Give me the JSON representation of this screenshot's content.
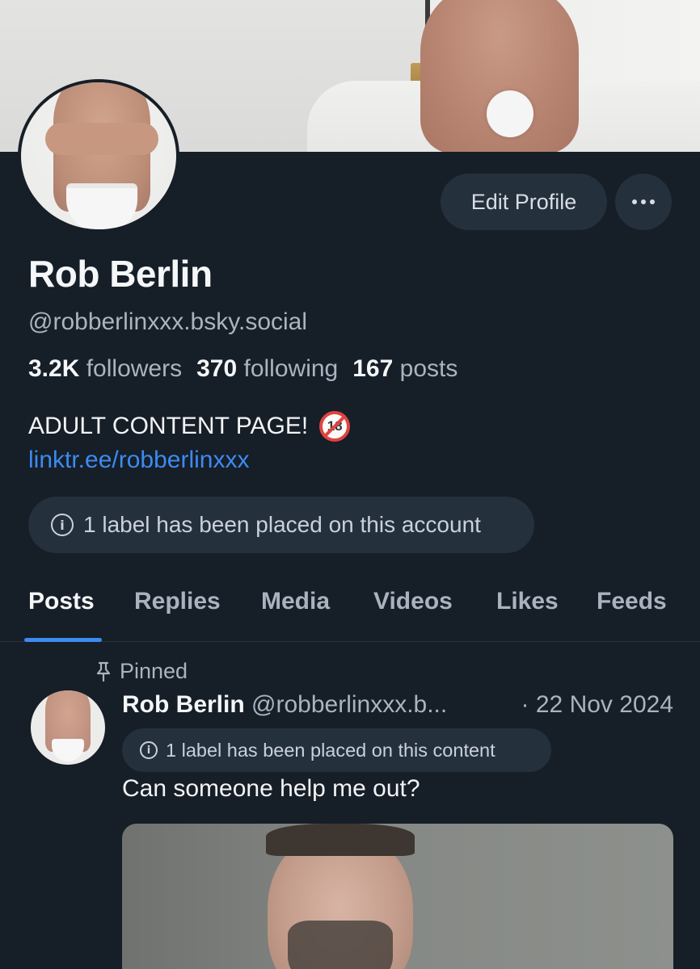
{
  "profile": {
    "edit_label": "Edit Profile",
    "display_name": "Rob Berlin",
    "handle": "@robberlinxxx.bsky.social",
    "stats": {
      "followers_count": "3.2K",
      "followers_label": "followers",
      "following_count": "370",
      "following_label": "following",
      "posts_count": "167",
      "posts_label": "posts"
    },
    "bio": "ADULT CONTENT PAGE!",
    "bio_badge": "18",
    "link": "linktr.ee/robberlinxxx",
    "account_label_notice": "1 label has been placed on this account"
  },
  "tabs": [
    "Posts",
    "Replies",
    "Media",
    "Videos",
    "Likes",
    "Feeds"
  ],
  "active_tab": "Posts",
  "post": {
    "pinned_label": "Pinned",
    "author_name": "Rob Berlin",
    "author_handle": "@robberlinxxx.b...",
    "date": "· 22 Nov 2024",
    "content_label_notice": "1 label has been placed on this content",
    "text": "Can someone help me out?"
  },
  "colors": {
    "background": "#161e27",
    "surface": "#25303d",
    "accent": "#3c8bf0",
    "muted_text": "#aab4c0"
  },
  "icons": [
    "info-icon",
    "pin-icon",
    "more-dots-icon",
    "no-under-18-icon"
  ]
}
